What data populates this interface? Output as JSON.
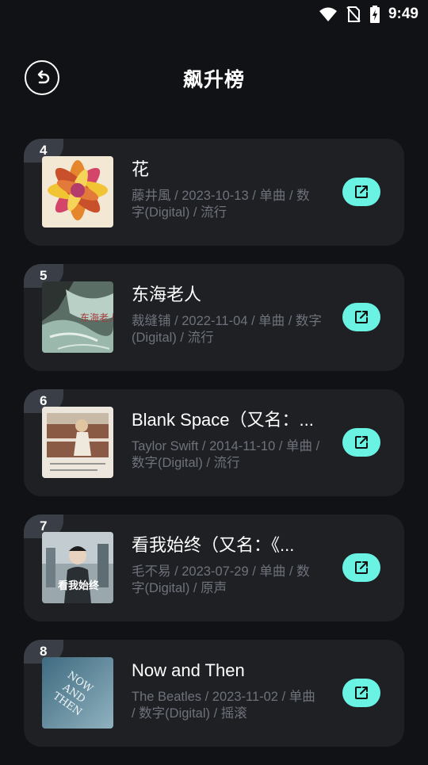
{
  "status_bar": {
    "time": "9:49"
  },
  "header": {
    "title": "飙升榜"
  },
  "items": [
    {
      "rank": "4",
      "title": "花",
      "meta": "藤井風 / 2023-10-13 / 单曲 / 数字(Digital) / 流行"
    },
    {
      "rank": "5",
      "title": "东海老人",
      "meta": "裁缝铺 / 2022-11-04 / 单曲 / 数字(Digital) / 流行"
    },
    {
      "rank": "6",
      "title": "Blank Space（又名：...",
      "meta": "Taylor Swift / 2014-11-10 / 单曲 / 数字(Digital) / 流行"
    },
    {
      "rank": "7",
      "title": "看我始终（又名：《...",
      "meta": "毛不易 / 2023-07-29 / 单曲 / 数字(Digital) / 原声"
    },
    {
      "rank": "8",
      "title": "Now and Then",
      "meta": "The Beatles / 2023-11-02 / 单曲 / 数字(Digital) / 摇滚"
    }
  ],
  "colors": {
    "accent": "#6af2e3",
    "card": "#1e2024",
    "background": "#111215"
  }
}
